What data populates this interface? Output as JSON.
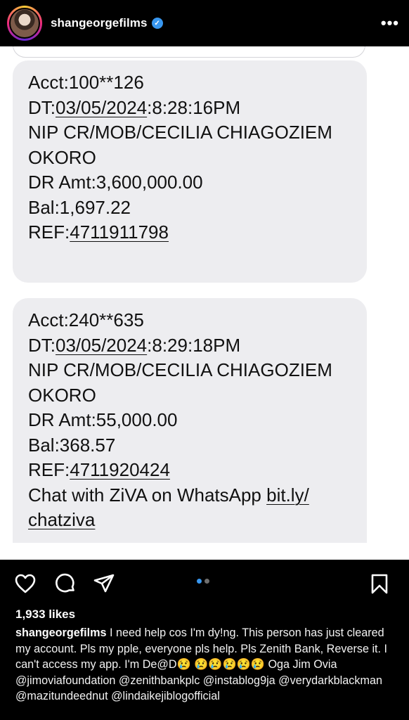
{
  "header": {
    "username": "shangeorgefilms",
    "verified_mark": "✓",
    "more_label": "•••"
  },
  "post": {
    "messages": [
      {
        "acct": "Acct:100**126",
        "dt_prefix": "DT:",
        "date": "03/05/2024",
        "colon": ":",
        "time": "8:28:16PM",
        "line3": "NIP CR/MOB/CECILIA CHIAGOZIEM",
        "line4": "OKORO",
        "amount": "DR Amt:3,600,000.00",
        "balance": "Bal:1,697.22",
        "ref_prefix": "REF:",
        "ref": "4711911798"
      },
      {
        "acct": "Acct:240**635",
        "dt_prefix": "DT:",
        "date": "03/05/2024",
        "colon": ":",
        "time": "8:29:18PM",
        "line3": "NIP CR/MOB/CECILIA CHIAGOZIEM",
        "line4": "OKORO",
        "amount": "DR Amt:55,000.00",
        "balance": "Bal:368.57",
        "ref_prefix": "REF:",
        "ref": "4711920424",
        "promo_text": "Chat with ZiVA on WhatsApp ",
        "promo_link_1": "bit.ly/",
        "promo_link_2": "chatziva"
      }
    ]
  },
  "actions": {
    "icons": [
      "heart-icon",
      "comment-icon",
      "share-icon",
      "bookmark-icon"
    ],
    "carousel": {
      "count": 2,
      "active_index": 0
    }
  },
  "likes": "1,933 likes",
  "caption": {
    "username": "shangeorgefilms",
    "text": " I need help cos I'm dy!ng. This person has just cleared my account. Pls my pple, everyone pls help. Pls Zenith Bank, Reverse it. I can't access my app. I'm De@D😢 😢😢😢😢😢 Oga Jim Ovia @jimoviafoundation @zenithbankplc @instablog9ja @verydarkblackman @mazitundeednut @lindaikejiblogofficial"
  },
  "colors": {
    "background": "#000000",
    "bubble": "#ededf0",
    "verified": "#3897f0",
    "carousel_active": "#3897f0"
  }
}
